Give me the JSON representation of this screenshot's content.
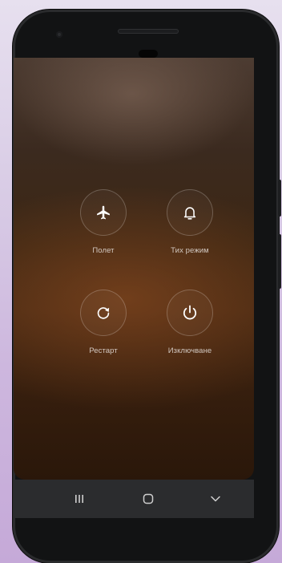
{
  "power_menu": {
    "items": [
      {
        "label": "Полет",
        "icon": "airplane-icon"
      },
      {
        "label": "Тих режим",
        "icon": "bell-icon"
      },
      {
        "label": "Рестарт",
        "icon": "restart-icon"
      },
      {
        "label": "Изключване",
        "icon": "power-icon"
      }
    ]
  },
  "navbar": {
    "buttons": [
      {
        "icon": "recents-icon"
      },
      {
        "icon": "home-icon"
      },
      {
        "icon": "back-chevron-icon"
      }
    ]
  },
  "colors": {
    "screen_top": "#4d3c32",
    "screen_middle": "#452812",
    "screen_bottom": "#2a170a",
    "navbar": "#2b2c2e",
    "phone_body": "#121314",
    "background": "#d8cbe5"
  }
}
